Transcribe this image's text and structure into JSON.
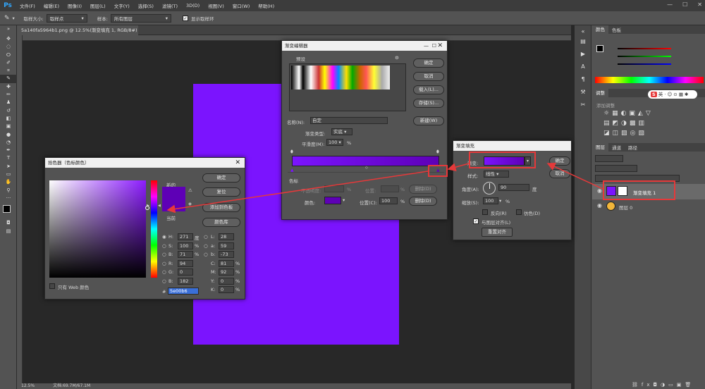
{
  "app": {
    "logo": "Ps",
    "menu": [
      "文件(F)",
      "编辑(E)",
      "图像(I)",
      "图层(L)",
      "文字(Y)",
      "选择(S)",
      "滤镜(T)",
      "3D(D)",
      "视图(V)",
      "窗口(W)",
      "帮助(H)"
    ]
  },
  "options": {
    "sample_size_label": "取样大小:",
    "sample_size_value": "取样点",
    "sample_label": "样本:",
    "sample_value": "所有图层",
    "show_ring_label": "显示取样环"
  },
  "document": {
    "tab_title": "5a140fa5964b1.png @ 12.5%(渐变填充 1, RGB/8#) *",
    "fill_color": "#7b14fe"
  },
  "status": {
    "zoom": "12.5%",
    "doc_info": "文档:69.7M/67.1M"
  },
  "panels": {
    "color_tabs": [
      "颜色",
      "色板"
    ],
    "adjust_tab": "调整",
    "adjust_hint": "添加调整",
    "layer_tabs": [
      "图层",
      "通道",
      "路径"
    ],
    "layers": [
      {
        "name": "渐变填充 1",
        "selected": true
      },
      {
        "name": "图层 0",
        "selected": false
      }
    ]
  },
  "gradient_editor": {
    "title": "渐变编辑器",
    "presets_label": "预设",
    "ok": "确定",
    "cancel": "取消",
    "load": "载入(L)...",
    "save": "存储(S)...",
    "name_label": "名称(N):",
    "name_value": "自定",
    "new_btn": "新建(W)",
    "type_label": "渐变类型:",
    "type_value": "实底",
    "smooth_label": "平滑度(M):",
    "smooth_value": "100",
    "smooth_unit": "%",
    "stops_label": "色标",
    "opacity_label": "不透明度:",
    "opacity_unit": "%",
    "location_label": "位置:",
    "location_unit": "%",
    "delete_btn": "删除(D)",
    "color_label": "颜色:",
    "location2_label": "位置(C):",
    "location2_value": "100",
    "location2_unit": "%",
    "delete2_btn": "删除(D)",
    "color_start": "#7b14fe",
    "color_end": "#5e00b6"
  },
  "gradient_fill": {
    "title": "渐变填充",
    "gradient_label": "渐变:",
    "ok": "确定",
    "cancel": "取消",
    "style_label": "样式:",
    "style_value": "线性",
    "angle_label": "角度(A):",
    "angle_value": "90",
    "angle_unit": "度",
    "scale_label": "缩放(S):",
    "scale_value": "100",
    "scale_unit": "%",
    "reverse_label": "反向(R)",
    "dither_label": "仿色(D)",
    "align_label": "与图层对齐(L)",
    "reset_btn": "重置对齐"
  },
  "color_picker": {
    "title": "拾色器（色标颜色）",
    "new_label": "新的",
    "current_label": "当前",
    "ok": "确定",
    "reset": "复位",
    "add_swatch": "添加到色板",
    "libraries": "颜色库",
    "web_only": "只有 Web 颜色",
    "fields": [
      {
        "k": "H:",
        "v": "271",
        "u": "度"
      },
      {
        "k": "S:",
        "v": "100",
        "u": "%"
      },
      {
        "k": "B:",
        "v": "71",
        "u": "%"
      },
      {
        "k": "R:",
        "v": "94",
        "u": ""
      },
      {
        "k": "G:",
        "v": "0",
        "u": ""
      },
      {
        "k": "B:",
        "v": "182",
        "u": ""
      }
    ],
    "lab": [
      {
        "k": "L:",
        "v": "28"
      },
      {
        "k": "a:",
        "v": "59"
      },
      {
        "k": "b:",
        "v": "-73"
      }
    ],
    "cmyk": [
      {
        "k": "C:",
        "v": "81",
        "u": "%"
      },
      {
        "k": "M:",
        "v": "92",
        "u": "%"
      },
      {
        "k": "Y:",
        "v": "0",
        "u": "%"
      },
      {
        "k": "K:",
        "v": "0",
        "u": "%"
      }
    ],
    "hex_label": "#",
    "hex": "5e00b6",
    "swatch": "#5e00b6"
  },
  "ime": {
    "label": "英"
  }
}
